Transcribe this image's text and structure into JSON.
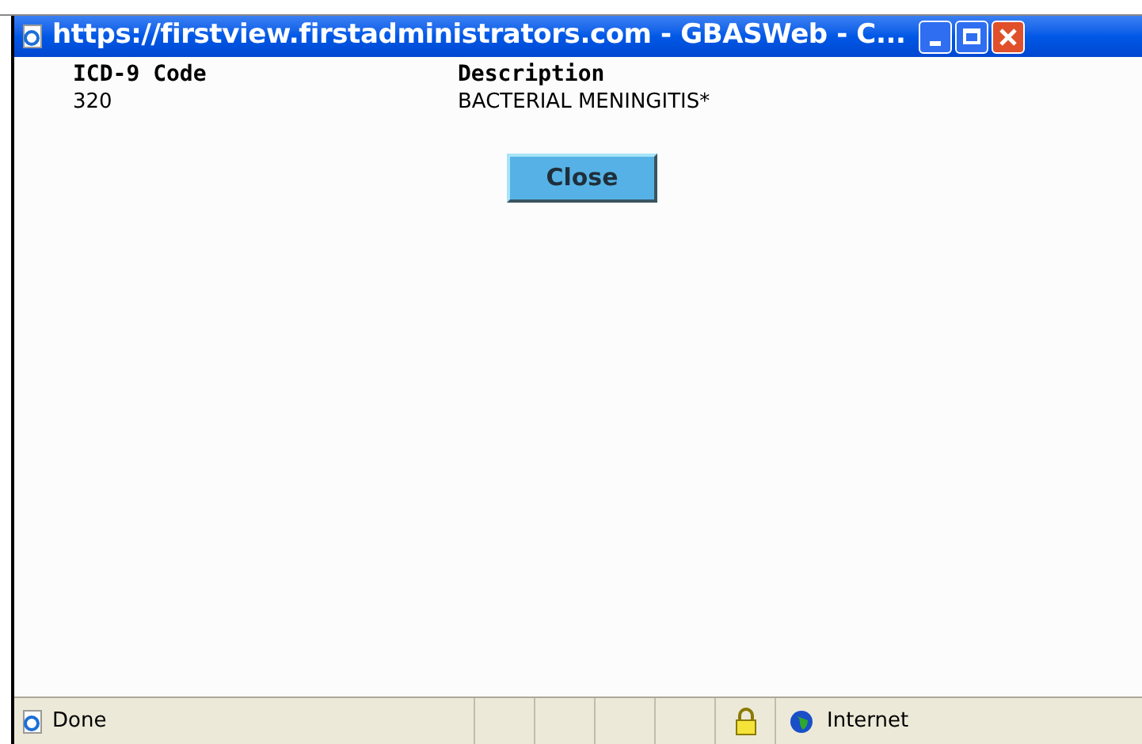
{
  "window": {
    "title": "https://firstview.firstadministrators.com - GBASWeb - C..."
  },
  "table": {
    "columns": [
      "ICD-9 Code",
      "Description"
    ],
    "rows": [
      [
        "320",
        "BACTERIAL MENINGITIS*"
      ]
    ]
  },
  "close_button": "Close",
  "status_bar": {
    "status": "Done",
    "zone": "Internet"
  }
}
